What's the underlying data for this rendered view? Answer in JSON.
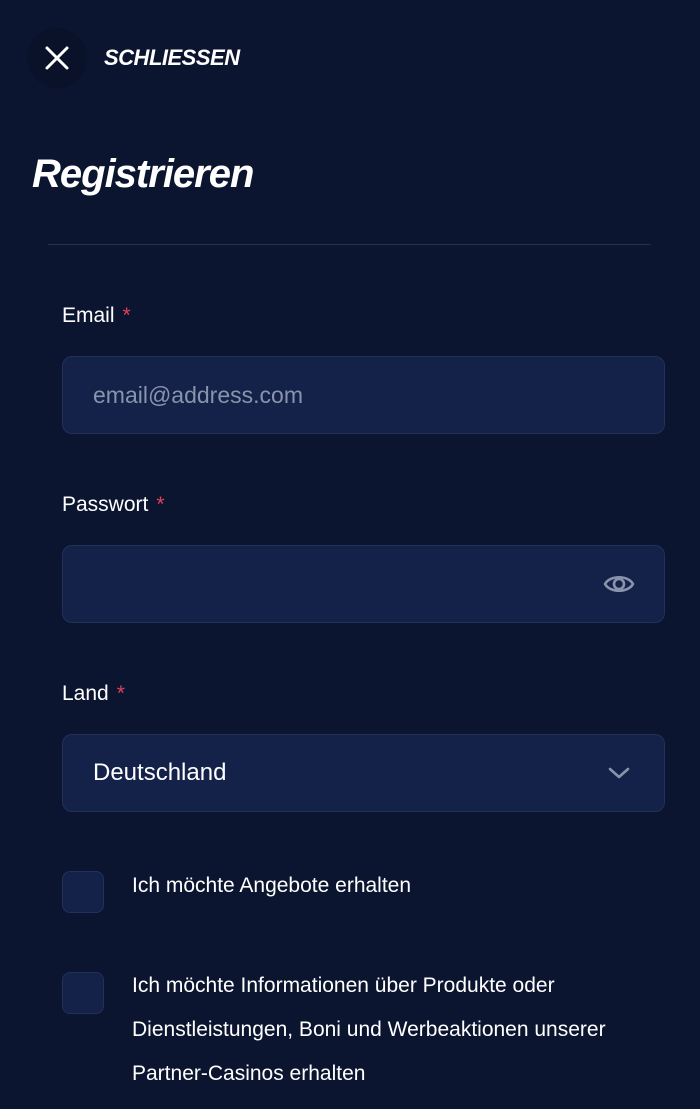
{
  "header": {
    "close_label": "SCHLIESSEN",
    "close_icon": "close-icon"
  },
  "title": "Registrieren",
  "form": {
    "email": {
      "label": "Email",
      "required_mark": "*",
      "placeholder": "email@address.com",
      "value": ""
    },
    "password": {
      "label": "Passwort",
      "required_mark": "*",
      "value": "",
      "toggle_icon": "eye-icon"
    },
    "country": {
      "label": "Land",
      "required_mark": "*",
      "selected": "Deutschland",
      "dropdown_icon": "chevron-down-icon"
    },
    "checkboxes": [
      {
        "label": "Ich möchte Angebote erhalten",
        "checked": false
      },
      {
        "label": "Ich möchte Informationen über Produkte oder Dienstleistungen, Boni und Werbeaktionen unserer Partner-Casinos erhalten",
        "checked": false
      }
    ]
  },
  "colors": {
    "background": "#0c1530",
    "input_background": "#14224a",
    "input_border": "#22305a",
    "required": "#e0405c",
    "placeholder": "#8a93ad",
    "divider": "#26304f"
  }
}
